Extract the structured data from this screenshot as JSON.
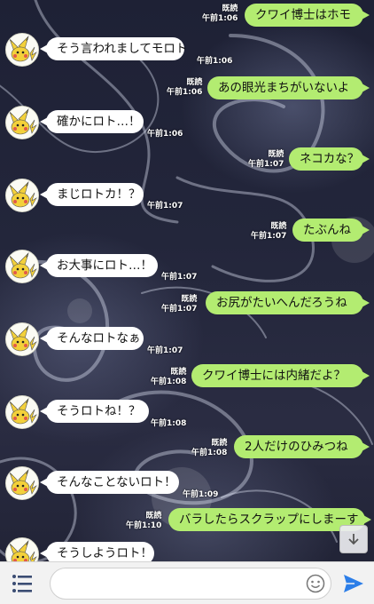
{
  "colors": {
    "incoming": "#ffffff",
    "outgoing": "#b3ec71",
    "background": "#22253a"
  },
  "messages": [
    {
      "side": "out",
      "text": "クワイ博士はホモ",
      "read": "既読",
      "time": "午前1:06"
    },
    {
      "side": "in",
      "text": "そう言われましてモロト",
      "time": "午前1:06"
    },
    {
      "side": "out",
      "text": "あの眼光まちがいないよ",
      "read": "既読",
      "time": "午前1:06"
    },
    {
      "side": "in",
      "text": "確かにロト…！",
      "time": "午前1:06"
    },
    {
      "side": "out",
      "text": "ネコカな？",
      "read": "既読",
      "time": "午前1:07"
    },
    {
      "side": "in",
      "text": "まじロトカ！？",
      "time": "午前1:07"
    },
    {
      "side": "out",
      "text": "たぶんね",
      "read": "既読",
      "time": "午前1:07"
    },
    {
      "side": "in",
      "text": "お大事にロト…！",
      "time": "午前1:07"
    },
    {
      "side": "out",
      "text": "お尻がたいへんだろうね",
      "read": "既読",
      "time": "午前1:07"
    },
    {
      "side": "in",
      "text": "そんなロトなぁ",
      "time": "午前1:07"
    },
    {
      "side": "out",
      "text": "クワイ博士には内緒だよ？",
      "read": "既読",
      "time": "午前1:08"
    },
    {
      "side": "in",
      "text": "そうロトね！？",
      "time": "午前1:08"
    },
    {
      "side": "out",
      "text": "2人だけのひみつね",
      "read": "既読",
      "time": "午前1:08"
    },
    {
      "side": "in",
      "text": "そんなことないロト！",
      "time": "午前1:09"
    },
    {
      "side": "out",
      "text": "バラしたらスクラップにしまーす",
      "read": "既読",
      "time": "午前1:10"
    },
    {
      "side": "in",
      "text": "そうしようロト！",
      "time": ""
    }
  ],
  "input": {
    "placeholder": ""
  },
  "icons": {
    "menu": "menu-icon",
    "emoji": "smiley-icon",
    "send": "send-icon",
    "scroll": "chevron-down-icon",
    "avatar": "pikachu-avatar-icon"
  }
}
